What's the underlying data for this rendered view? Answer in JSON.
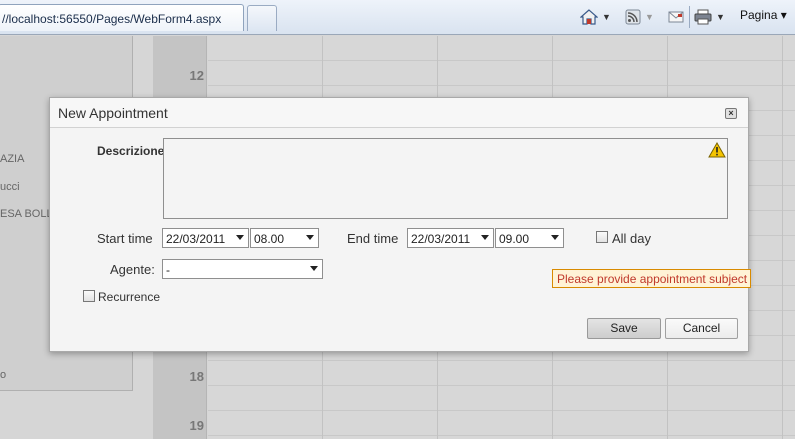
{
  "browser": {
    "tab_title": "//localhost:56550/Pages/WebForm4.aspx",
    "pagina_label": "Pagina ▾"
  },
  "background": {
    "left_items": [
      "AZIA",
      "ucci",
      "ESA BOLL",
      "o"
    ],
    "hours": [
      "12",
      "18",
      "19"
    ]
  },
  "dialog": {
    "title": "New Appointment",
    "close_glyph": "×",
    "description_label": "Descrizione",
    "description_value": "",
    "start_time_label": "Start time",
    "start_date": "22/03/2011",
    "start_time": "08.00",
    "end_time_label": "End time",
    "end_date": "22/03/2011",
    "end_time": "09.00",
    "all_day_label": "All day",
    "all_day_checked": false,
    "agente_label": "Agente:",
    "agente_value": "-",
    "recurrence_label": "Recurrence",
    "recurrence_checked": false,
    "validation_message": "Please provide appointment subject",
    "save_label": "Save",
    "cancel_label": "Cancel"
  },
  "icons": {
    "home": "home-icon",
    "feeds": "rss-icon",
    "mail": "mail-icon",
    "print": "printer-icon",
    "warning": "warning-icon"
  },
  "colors": {
    "tooltip_bg": "#fff3d6",
    "tooltip_border": "#d88a00",
    "tooltip_text": "#c0392b"
  }
}
